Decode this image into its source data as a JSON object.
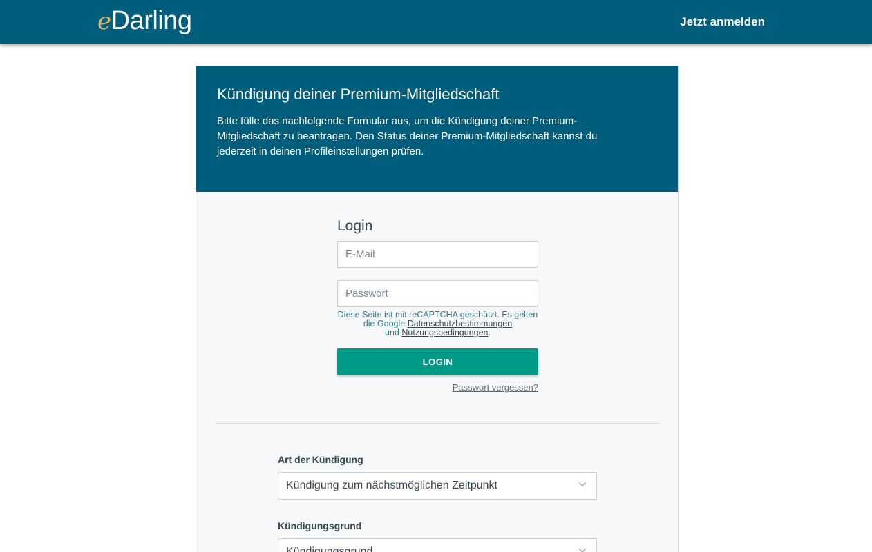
{
  "header": {
    "logo_e": "e",
    "logo_rest": "Darling",
    "signup_label": "Jetzt anmelden"
  },
  "intro": {
    "title": "Kündigung deiner Premium-Mitgliedschaft",
    "text": "Bitte fülle das nachfolgende Formular aus, um die Kündigung deiner Premium-Mitgliedschaft zu beantragen. Den Status deiner Premium-Mitgliedschaft kannst du jederzeit in deinen Profileinstellungen prüfen."
  },
  "login": {
    "title": "Login",
    "email_placeholder": "E-Mail",
    "email_value": "",
    "password_placeholder": "Passwort",
    "password_value": "",
    "recaptcha_pre": "Diese Seite ist mit reCAPTCHA geschützt. Es gelten die Google ",
    "privacy_link": "Datenschutzbestimmungen",
    "recaptcha_and": " und ",
    "terms_link": "Nutzungsbedingungen",
    "recaptcha_end": ".",
    "button_label": "LOGIN",
    "forgot_label": "Passwort vergessen?"
  },
  "cancellation": {
    "type_label": "Art der Kündigung",
    "type_value": "Kündigung zum nächstmöglichen Zeitpunkt",
    "reason_label": "Kündigungsgrund",
    "reason_value": "Kündigungsgrund"
  },
  "icons": {
    "chevron": "chevron-down-icon"
  },
  "colors": {
    "brand": "#005e7c",
    "accent": "#009b87",
    "logo_e": "#d7b36a"
  }
}
